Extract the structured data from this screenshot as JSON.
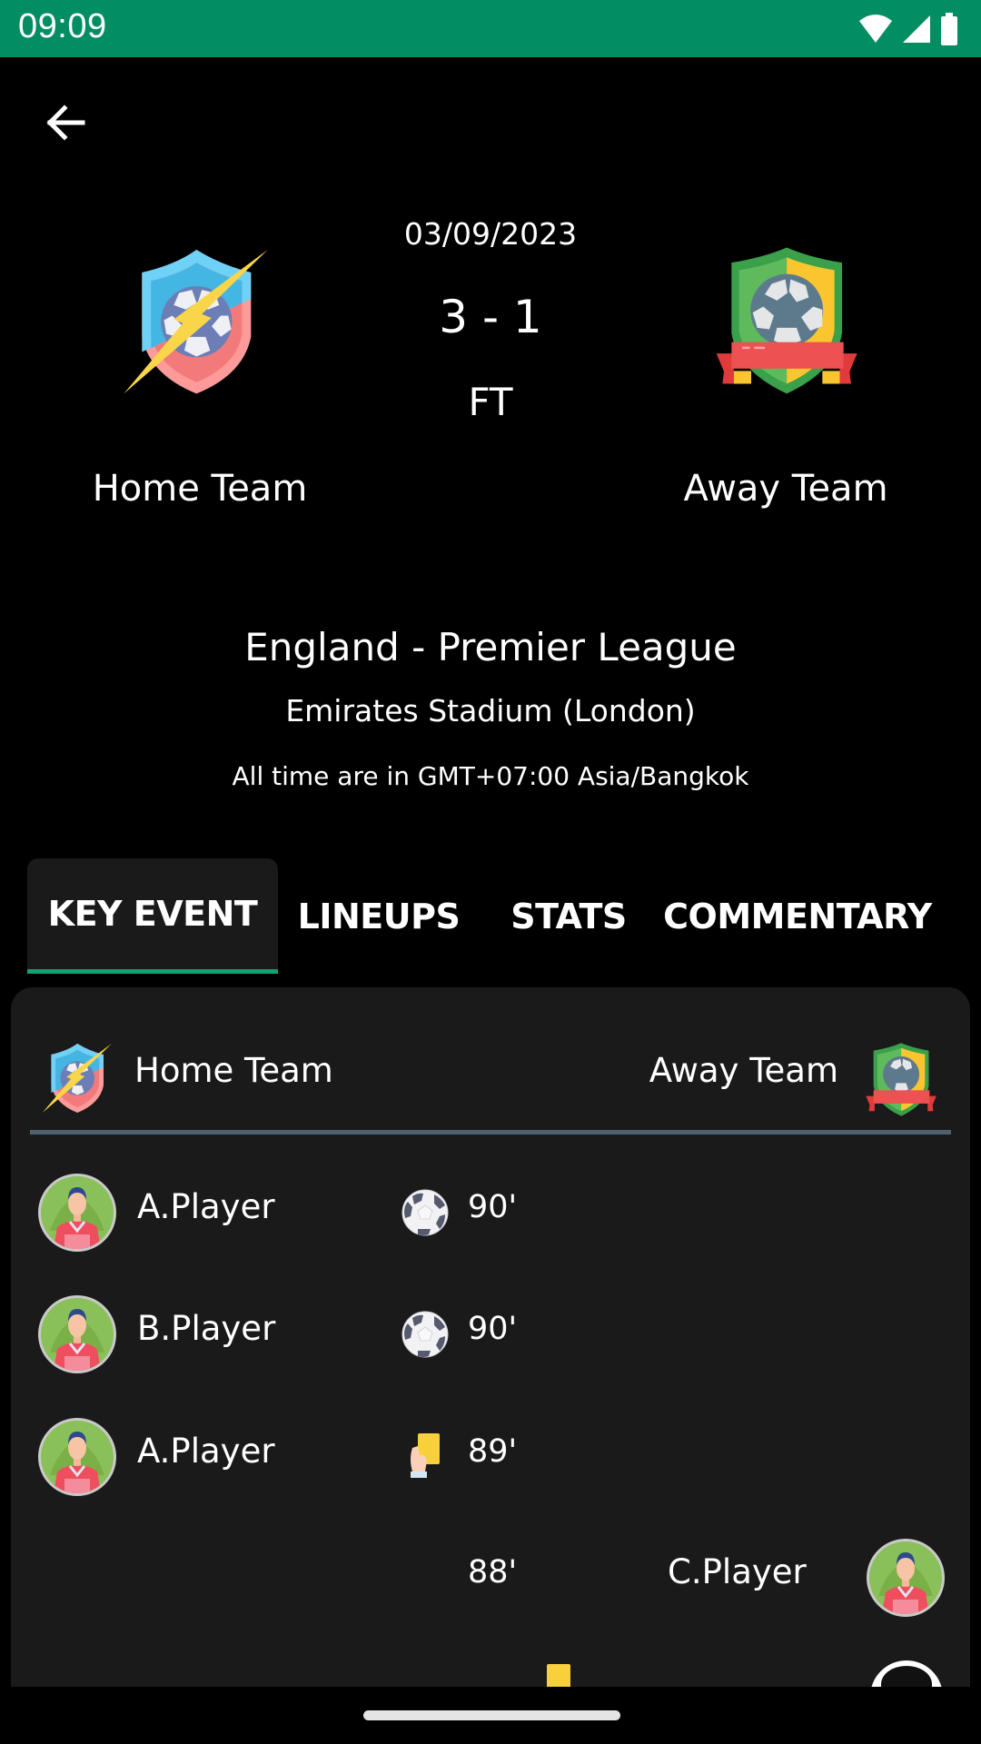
{
  "status_bar": {
    "time": "09:09",
    "icons": [
      "wifi-icon",
      "signal-icon",
      "battery-icon"
    ],
    "background": "#028d63"
  },
  "header": {
    "back_icon": "arrow-left-icon"
  },
  "match": {
    "date": "03/09/2023",
    "score": "3 - 1",
    "status": "FT",
    "home_team": "Home Team",
    "away_team": "Away Team",
    "home_logo": "shield-lightning-ball-logo",
    "away_logo": "shield-ribbon-ball-logo"
  },
  "league": {
    "name": "England - Premier League",
    "stadium": "Emirates Stadium (London)",
    "timezone_note": "All time are in GMT+07:00 Asia/Bangkok"
  },
  "tabs": [
    {
      "label": "KEY EVENT",
      "active": true
    },
    {
      "label": "LINEUPS",
      "active": false
    },
    {
      "label": "STATS",
      "active": false
    },
    {
      "label": "COMMENTARY",
      "active": false
    }
  ],
  "accent_color": "#14a070",
  "key_events": {
    "home_team": "Home Team",
    "away_team": "Away Team",
    "events": [
      {
        "side": "home",
        "player": "A.Player",
        "type": "goal",
        "icon": "soccer-ball-icon",
        "minute": "90'"
      },
      {
        "side": "home",
        "player": "B.Player",
        "type": "goal",
        "icon": "soccer-ball-icon",
        "minute": "90'"
      },
      {
        "side": "home",
        "player": "A.Player",
        "type": "yellow-card",
        "icon": "yellow-card-icon",
        "minute": "89'"
      },
      {
        "side": "away",
        "player": "C.Player",
        "type": "none",
        "icon": "",
        "minute": "88'"
      }
    ]
  }
}
